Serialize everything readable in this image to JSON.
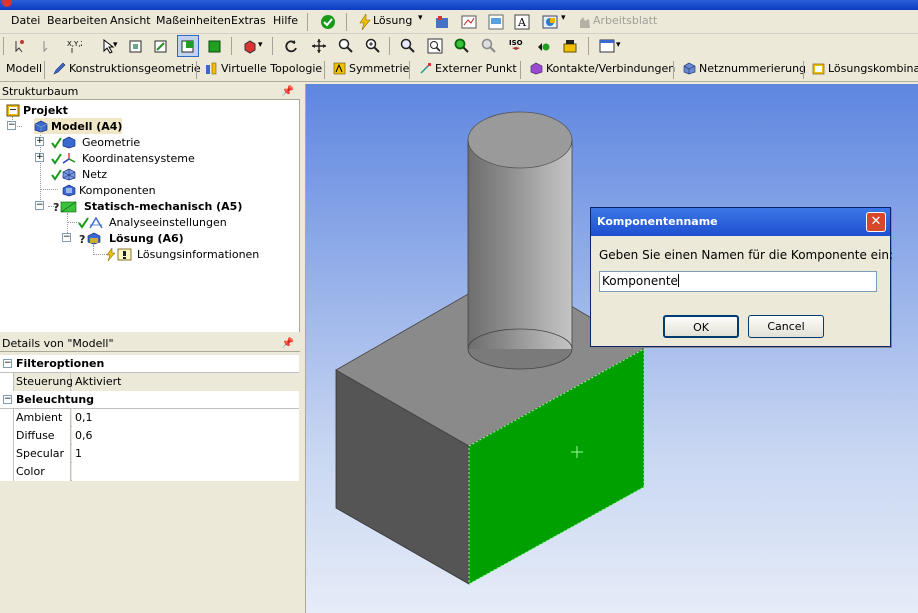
{
  "menubar": {
    "items": [
      "Datei",
      "Bearbeiten",
      "Ansicht",
      "Maßeinheiten",
      "Extras",
      "Hilfe"
    ],
    "loesung_label": "Lösung",
    "arbeitsblatt_label": "Arbeitsblatt"
  },
  "toolbar2": {
    "items": [
      "Modell",
      "Konstruktionsgeometrie",
      "Virtuelle Topologie",
      "Symmetrie",
      "Externer Punkt",
      "Kontakte/Verbindungen",
      "Netznummerierung",
      "Lösungskombination"
    ]
  },
  "tree": {
    "header": "Strukturbaum",
    "nodes": [
      {
        "label": "Projekt"
      },
      {
        "label": "Modell (A4)"
      },
      {
        "label": "Geometrie"
      },
      {
        "label": "Koordinatensysteme"
      },
      {
        "label": "Netz"
      },
      {
        "label": "Komponenten"
      },
      {
        "label": "Statisch-mechanisch (A5)"
      },
      {
        "label": "Analyseeinstellungen"
      },
      {
        "label": "Lösung (A6)"
      },
      {
        "label": "Lösungsinformationen"
      }
    ]
  },
  "details": {
    "header": "Details von \"Modell\"",
    "groups": [
      {
        "title": "Filteroptionen",
        "rows": [
          {
            "key": "Steuerung",
            "value": "Aktiviert"
          }
        ]
      },
      {
        "title": "Beleuchtung",
        "rows": [
          {
            "key": "Ambient",
            "value": "0,1"
          },
          {
            "key": "Diffuse",
            "value": "0,6"
          },
          {
            "key": "Specular",
            "value": "1"
          },
          {
            "key": "Color",
            "value": ""
          }
        ]
      }
    ]
  },
  "dialog": {
    "title": "Komponentenname",
    "prompt": "Geben Sie einen Namen für die Komponente ein:",
    "field_value": "Komponente",
    "ok_label": "OK",
    "cancel_label": "Cancel"
  },
  "colors": {
    "selected_face": "#00a000",
    "body_face_dark": "#555555",
    "body_face_top": "#8a8a8a",
    "cylinder": "#9a9a9a"
  }
}
